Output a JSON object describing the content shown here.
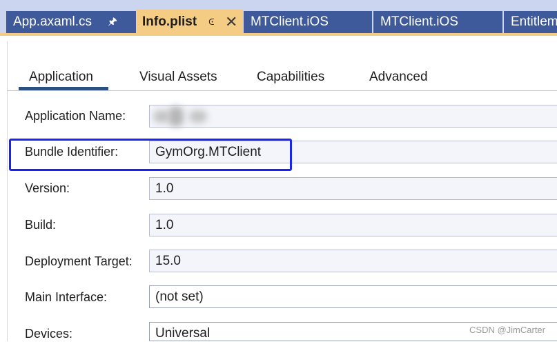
{
  "doc_tabs": [
    {
      "label": "App.axaml.cs",
      "pin_icon": "pin-icon"
    },
    {
      "label": "Info.plist",
      "pin_icon": "pin-icon",
      "close_icon": "close-icon",
      "active": true
    },
    {
      "label": "MTClient.iOS"
    },
    {
      "label": "MTClient.iOS"
    },
    {
      "label": "Entitlem"
    }
  ],
  "page_tabs": [
    {
      "label": "Application",
      "selected": true
    },
    {
      "label": "Visual Assets"
    },
    {
      "label": "Capabilities"
    },
    {
      "label": "Advanced"
    }
  ],
  "fields": {
    "app_name": {
      "label": "Application Name:",
      "value": ""
    },
    "bundle_id": {
      "label": "Bundle Identifier:",
      "value": "GymOrg.MTClient"
    },
    "version": {
      "label": "Version:",
      "value": "1.0"
    },
    "build": {
      "label": "Build:",
      "value": "1.0"
    },
    "deployment_target": {
      "label": "Deployment Target:",
      "value": "15.0"
    },
    "main_interface": {
      "label": "Main Interface:",
      "value": "(not set)"
    },
    "devices": {
      "label": "Devices:",
      "value": "Universal"
    }
  },
  "watermark": "CSDN @JimCarter",
  "colors": {
    "tabbar_bg": "#ccd5f0",
    "tab_inactive": "#3f5a9a",
    "tab_active": "#f5cc84",
    "selected_tab_underline": "#2b4f7e",
    "highlight": "#1a23ef"
  }
}
